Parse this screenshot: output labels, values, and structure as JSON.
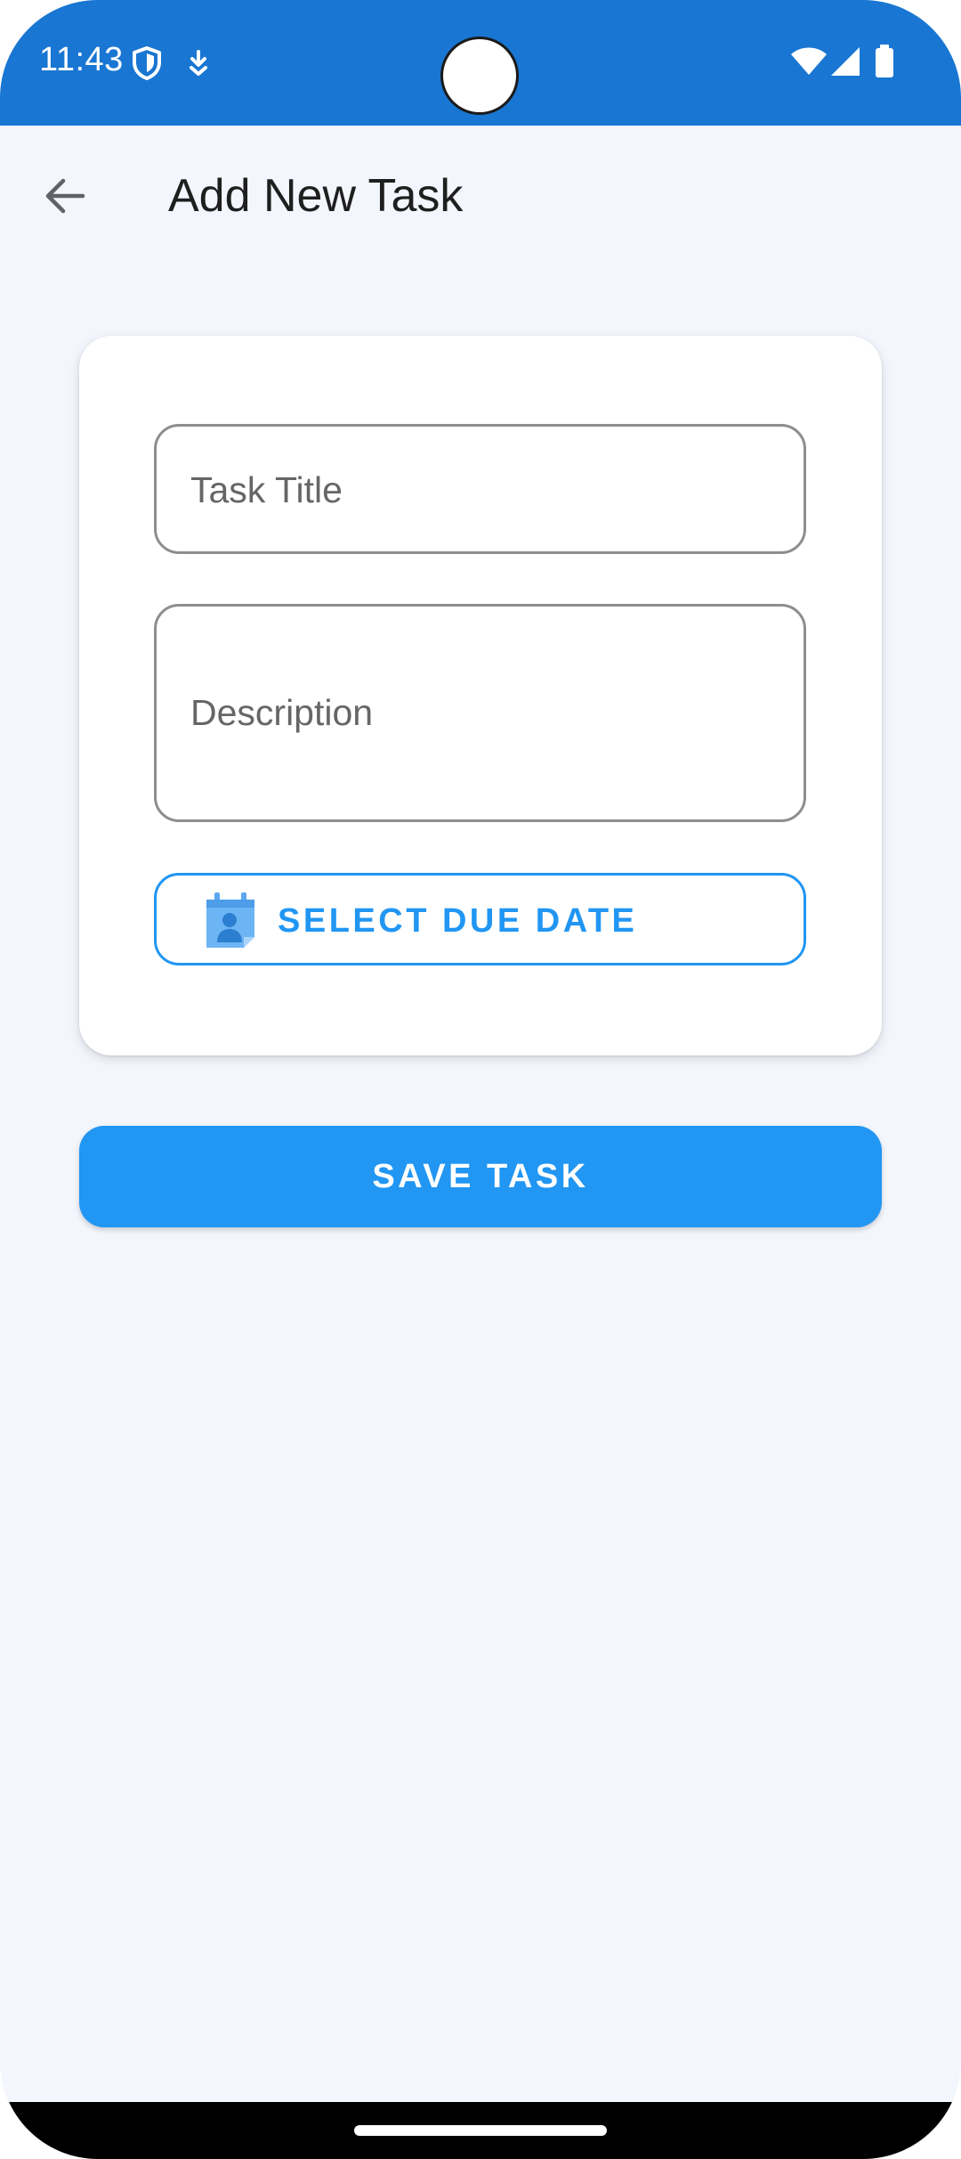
{
  "status_bar": {
    "time": "11:43",
    "icons": [
      "shield-icon",
      "download-icon",
      "wifi-icon",
      "signal-icon",
      "battery-icon"
    ],
    "background": "#1976d2"
  },
  "app_bar": {
    "back_icon": "arrow-back-icon",
    "title": "Add New Task"
  },
  "form": {
    "title_field": {
      "placeholder": "Task Title",
      "value": ""
    },
    "description_field": {
      "placeholder": "Description",
      "value": ""
    },
    "due_date_button": {
      "icon": "calendar-person-icon",
      "label": "SELECT DUE DATE"
    }
  },
  "save_button": {
    "label": "SAVE TASK"
  },
  "colors": {
    "accent": "#2196f3",
    "background": "#f3f6fd",
    "card": "#ffffff"
  }
}
